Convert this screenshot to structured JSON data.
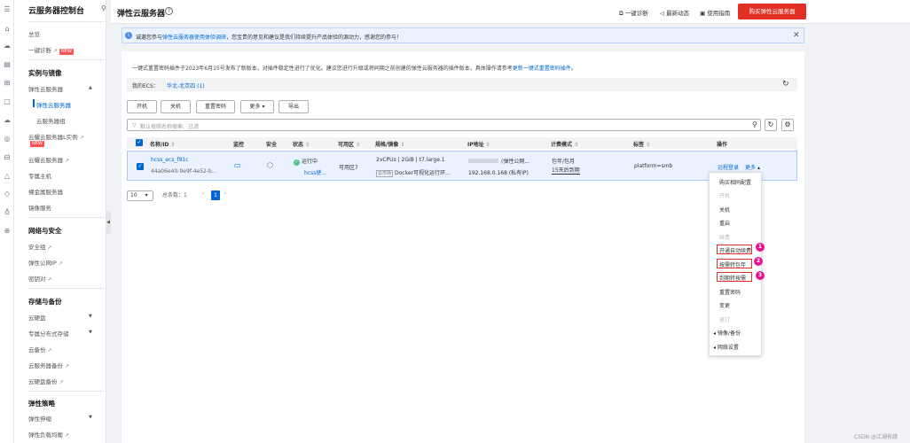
{
  "rail": {
    "icons": [
      "home-icon",
      "cloud-icon",
      "server-icon",
      "database-icon",
      "storage-icon",
      "doc-icon",
      "cloud-outline-icon",
      "network-icon",
      "warning-icon",
      "security-icon",
      "shield-icon",
      "globe-icon"
    ]
  },
  "sidebar": {
    "title": "云服务器控制台",
    "overview": "总览",
    "diagnose": "一键诊断",
    "new_badge": "NEW",
    "sec_instances": "实例与镜像",
    "ecs": "弹性云服务器",
    "ecs_sub": "弹性云服务器",
    "ecs_group": "云服务器组",
    "flexus": "云耀云服务器L实例",
    "flexus_x": "云耀云服务器",
    "dedicated": "专属主机",
    "bms": "裸金属服务器",
    "ims": "镜像服务",
    "sec_network": "网络与安全",
    "sg": "安全组",
    "eip": "弹性公网IP",
    "keypair": "密钥对",
    "sec_storage": "存储与备份",
    "evs": "云硬盘",
    "dss": "专属分布式存储",
    "cbr": "云备份",
    "csbs": "云服务器备份",
    "vbs": "云硬盘备份",
    "sec_elastic": "弹性策略",
    "as": "弹性伸缩",
    "elb": "弹性负载均衡"
  },
  "header": {
    "title": "弹性云服务器",
    "diagnose": "一键诊断",
    "news": "最新动态",
    "guide": "使用指南",
    "buy": "购买弹性云服务器"
  },
  "notice": {
    "pre": "诚邀您参与",
    "link": "弹性云服务器使用体验调研",
    "post": "，您宝贵的意见和建议是我们持续提升产品体验的源动力，感谢您的参与！"
  },
  "panel": {
    "info_pre": "一键式重置密码插件于2023年6月15号发布了新版本，对插件稳定性进行了优化。建议您进行升级或将同期之前创建的弹性云服务器的插件版本，具体操作请参考",
    "info_link": "更新一键式重置密码插件",
    "info_post": "。",
    "ecs_label": "我的ECS：",
    "ecs_region": "华北-北京四 (1)",
    "buttons": [
      "开机",
      "关机",
      "重置密码",
      "更多",
      "导出"
    ],
    "search_placeholder": "默认按照名称搜索、过滤"
  },
  "table": {
    "headers": [
      "名称/ID",
      "监控",
      "安全",
      "状态",
      "可用区",
      "规格/镜像",
      "IP地址",
      "计费模式",
      "标签",
      "操作"
    ],
    "row": {
      "name": "hcss_ecs_f91c",
      "id": "44a06e40-9e9f-4e52-b...",
      "status": "运行中",
      "status_sub": "hcss使...",
      "az": "可用区7",
      "spec": "2vCPUs | 2GiB | t7.large.1",
      "image_tag": "云市场",
      "image": "Docker可视化运行环...",
      "ip_suffix": "(弹性公网...",
      "ip_private": "192.168.0.168 (私有IP)",
      "billing": "包年/包月",
      "expire": "15天后到期",
      "tag": "platform=smb",
      "op_login": "远程登录",
      "op_more": "更多"
    }
  },
  "pager": {
    "size": "10",
    "total": "总条数：1",
    "page": "1"
  },
  "dropdown": {
    "items": [
      {
        "label": "购买相同配置",
        "state": "enabled"
      },
      {
        "label": "开机",
        "state": "disabled"
      },
      {
        "label": "关机",
        "state": "enabled"
      },
      {
        "label": "重启",
        "state": "enabled"
      },
      {
        "label": "续费",
        "state": "disabled"
      },
      {
        "label": "开通自动续费",
        "state": "highlighted"
      },
      {
        "label": "按需转包年",
        "state": "highlighted"
      },
      {
        "label": "到期转按需",
        "state": "highlighted"
      },
      {
        "label": "重置密码",
        "state": "enabled"
      },
      {
        "label": "变更",
        "state": "enabled"
      },
      {
        "label": "退订",
        "state": "disabled"
      },
      {
        "label": "镜像/备份",
        "state": "submenu"
      },
      {
        "label": "网络设置",
        "state": "submenu"
      }
    ],
    "badges": [
      "1",
      "2",
      "3"
    ]
  },
  "watermark": "CSDN @江湖有缘",
  "colors": {
    "accent": "#0067d1",
    "buy": "#e22f25",
    "badge": "#e4148f",
    "running": "#50c38a"
  }
}
